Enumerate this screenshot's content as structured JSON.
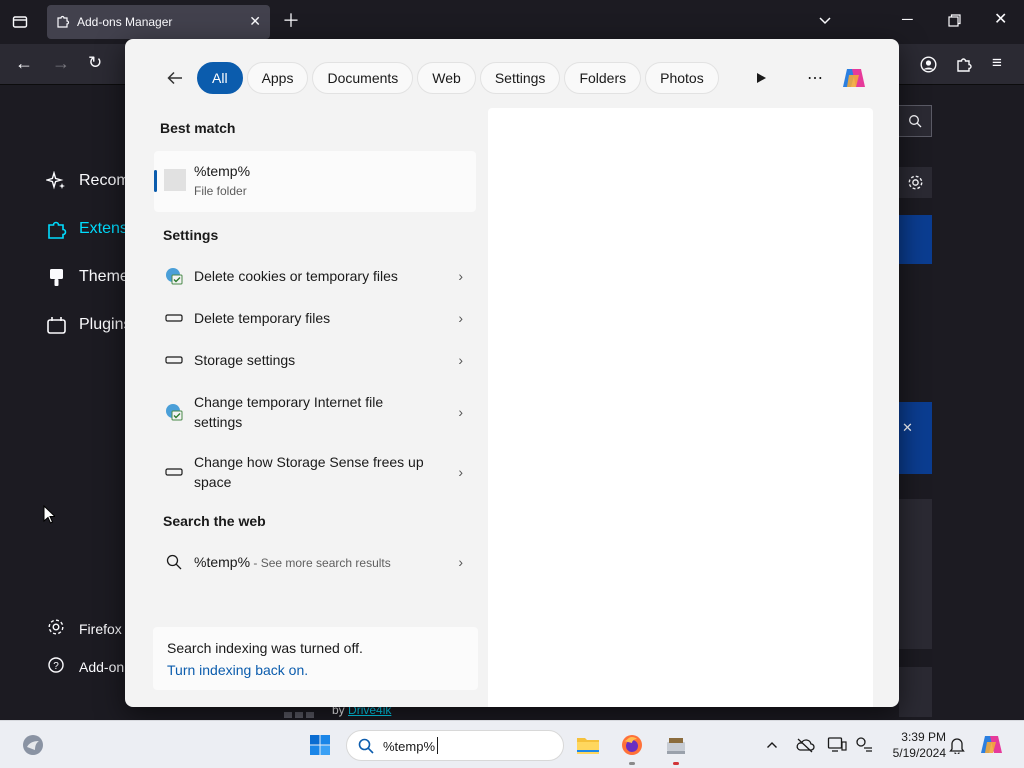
{
  "browser": {
    "tab_title": "Add-ons Manager",
    "window_controls": [
      "minimize",
      "restore",
      "close"
    ]
  },
  "addons_page": {
    "categories": [
      {
        "label": "Recom",
        "icon": "sparkle-icon"
      },
      {
        "label": "Extens",
        "icon": "puzzle-icon"
      },
      {
        "label": "Theme",
        "icon": "brush-icon"
      },
      {
        "label": "Plugins",
        "icon": "plugin-icon"
      }
    ],
    "footer": [
      {
        "label": "Firefox S",
        "icon": "gear-icon"
      },
      {
        "label": "Add-on",
        "icon": "help-icon"
      }
    ],
    "bottom_text": {
      "prefix": "by",
      "link": "Drive4ik"
    }
  },
  "search_flyout": {
    "filters": [
      "All",
      "Apps",
      "Documents",
      "Web",
      "Settings",
      "Folders",
      "Photos"
    ],
    "active_filter": "All",
    "best_match_heading": "Best match",
    "best_match": {
      "title": "%temp%",
      "subtitle": "File folder"
    },
    "settings_heading": "Settings",
    "settings_items": [
      {
        "label": "Delete cookies or temporary files",
        "icon": "internet-options-icon"
      },
      {
        "label": "Delete temporary files",
        "icon": "storage-icon"
      },
      {
        "label": "Storage settings",
        "icon": "storage-icon"
      },
      {
        "label": "Change temporary Internet file settings",
        "icon": "internet-options-icon"
      },
      {
        "label": "Change how Storage Sense frees up space",
        "icon": "storage-icon"
      }
    ],
    "web_heading": "Search the web",
    "web_item": {
      "query": "%temp%",
      "hint": " - See more search results"
    },
    "notice": {
      "text": "Search indexing was turned off.",
      "link": "Turn indexing back on."
    }
  },
  "taskbar": {
    "search_value": "%temp%",
    "pinned": [
      "file-explorer-icon",
      "firefox-icon",
      "app-icon"
    ],
    "time": "3:39 PM",
    "date": "5/19/2024"
  }
}
